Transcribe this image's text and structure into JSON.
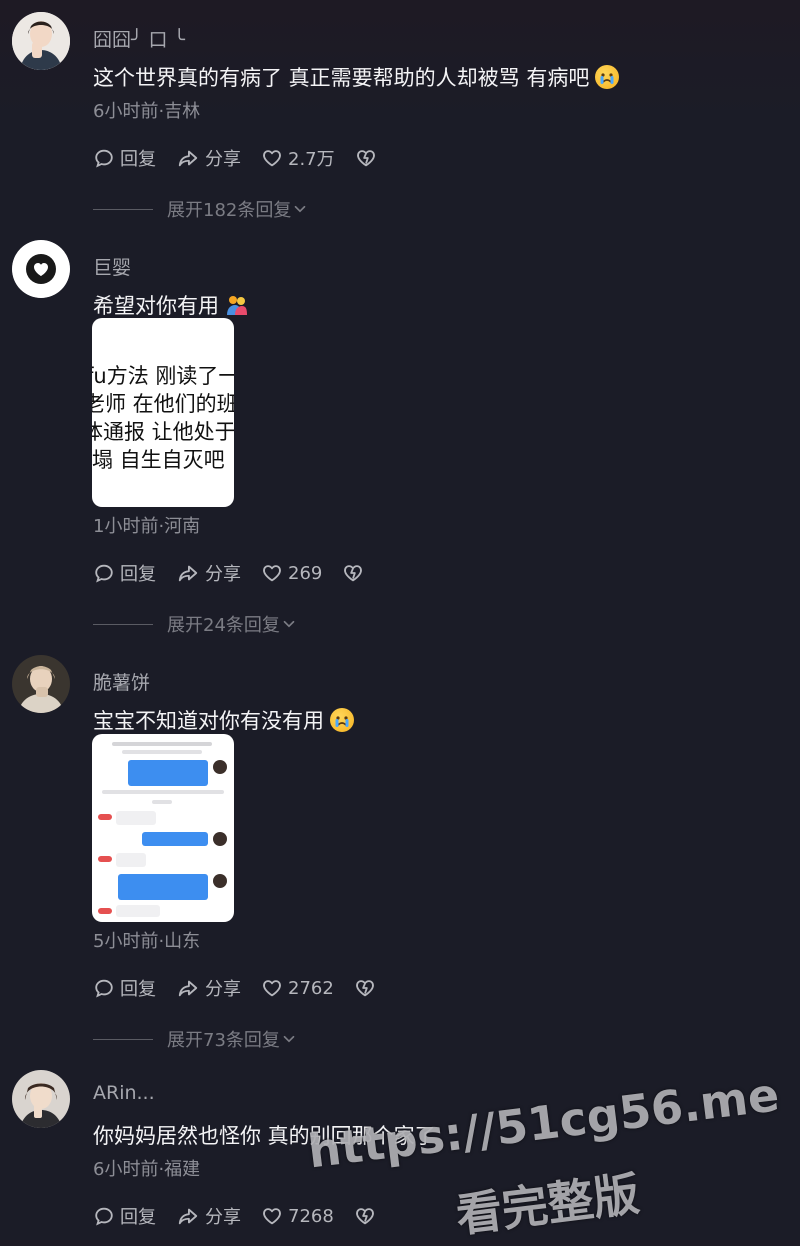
{
  "actions": {
    "reply": "回复",
    "share": "分享"
  },
  "comments": [
    {
      "username": "囧囧╯ 口 ╰",
      "text": "这个世界真的有病了 真正需要帮助的人却被骂 有病吧",
      "emoji": "crying-face",
      "meta": "6小时前·吉林",
      "likes": "2.7万",
      "expand": "展开182条回复"
    },
    {
      "username": "巨婴",
      "text": "希望对你有用",
      "emoji": "people-hugging",
      "image_lines": [
        "fu方法 刚读了一",
        "老师 在他们的班级",
        "体通报 让他处于",
        "塌 自生自灭吧"
      ],
      "meta": "1小时前·河南",
      "likes": "269",
      "expand": "展开24条回复"
    },
    {
      "username": "脆薯饼",
      "text": "宝宝不知道对你有没有用",
      "emoji": "crying-face",
      "meta": "5小时前·山东",
      "likes": "2762",
      "expand": "展开73条回复"
    },
    {
      "username": "ARin...",
      "text": "你妈妈居然也怪你 真的别回那个家了",
      "meta": "6小时前·福建",
      "likes": "7268"
    }
  ],
  "watermark": {
    "url": "https://51cg56.me",
    "caption": "看完整版"
  },
  "colors": {
    "background": "#1b1c27",
    "meta": "#8d8e96",
    "chat_bubble": "#3d8ef0"
  }
}
